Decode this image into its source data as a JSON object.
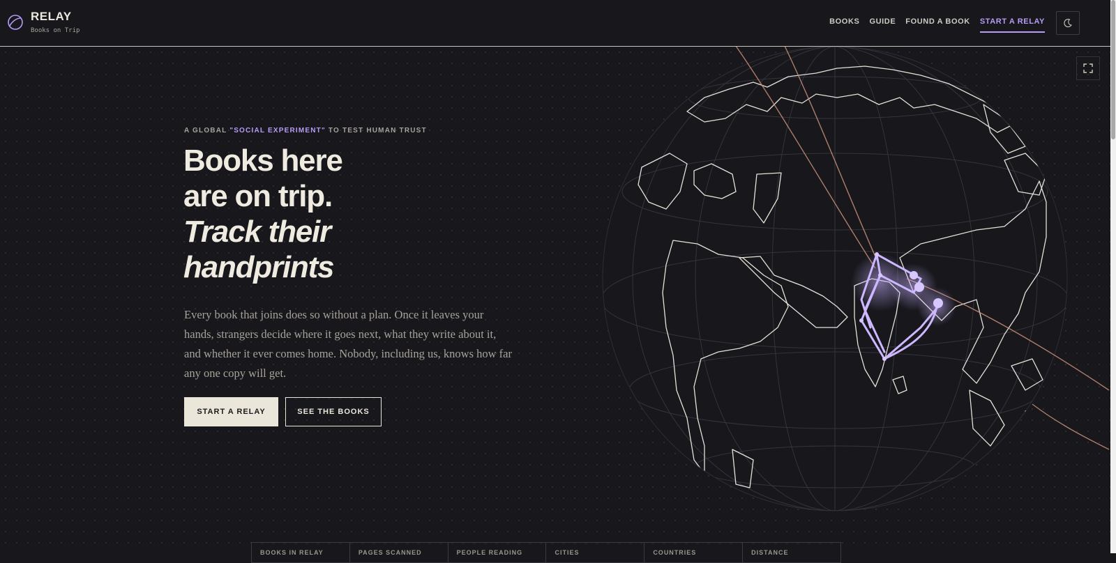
{
  "brand": {
    "title": "RELAY",
    "subtitle": "Books on Trip"
  },
  "nav": {
    "items": [
      "BOOKS",
      "GUIDE",
      "FOUND A BOOK",
      "START A RELAY"
    ],
    "active": "START A RELAY"
  },
  "icons": {
    "brand": "orbit-logo-icon",
    "theme": "moon-icon",
    "fullscreen": "expand-icon"
  },
  "hero": {
    "eyebrow_pre": "A GLOBAL ",
    "eyebrow_highlight": "\"SOCIAL EXPERIMENT\"",
    "eyebrow_post": " TO TEST HUMAN TRUST",
    "headline_line1": "Books here",
    "headline_line2": "are on trip.",
    "headline_line3": "Track their",
    "headline_line4": "handprints",
    "body": "Every book that joins does so without a plan. Once it leaves your hands, strangers decide where it goes next, what they write about it, and whether it ever comes home. Nobody, including us, knows how far any one copy will get.",
    "primary_cta": "START A RELAY",
    "secondary_cta": "SEE THE BOOKS"
  },
  "stats": [
    "BOOKS IN RELAY",
    "PAGES SCANNED",
    "PEOPLE READING",
    "CITIES",
    "COUNTRIES",
    "DISTANCE"
  ],
  "colors": {
    "background": "#17171c",
    "accent": "#b79cf5",
    "text": "#efebe1",
    "route": "#c8907a"
  }
}
